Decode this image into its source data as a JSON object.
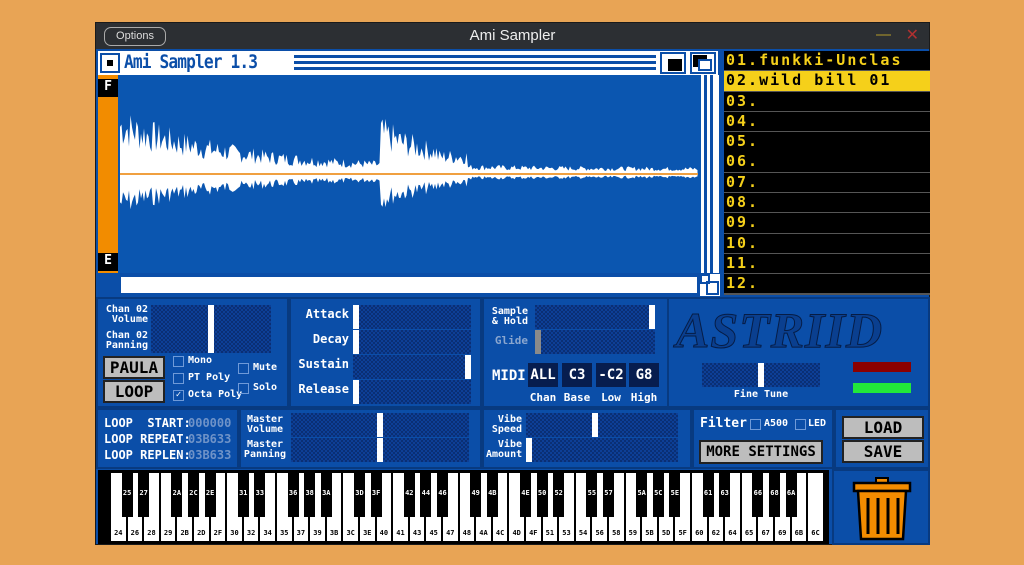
{
  "window": {
    "title": "Ami Sampler",
    "options_label": "Options",
    "minimize_glyph": "—",
    "close_glyph": "✕"
  },
  "app": {
    "title": "Ami Sampler 1.3",
    "wave_top_label": "F",
    "wave_bottom_label": "E"
  },
  "samples": [
    "01.funkki-Unclas",
    "02.wild bill 01",
    "03.",
    "04.",
    "05.",
    "06.",
    "07.",
    "08.",
    "09.",
    "10.",
    "11.",
    "12."
  ],
  "selected_sample": 1,
  "channel": {
    "volume_label": [
      "Chan 02",
      "Volume"
    ],
    "panning_label": [
      "Chan 02",
      "Panning"
    ],
    "volume": 0.5,
    "panning": 0.5,
    "paula_label": "PAULA",
    "loop_label": "LOOP",
    "options": [
      {
        "label": "Mono",
        "checked": false
      },
      {
        "label": "PT Poly",
        "checked": false
      },
      {
        "label": "Octa Poly",
        "checked": true
      },
      {
        "label": "Mute",
        "checked": false
      },
      {
        "label": "Solo",
        "checked": false
      }
    ]
  },
  "envelope": {
    "attack_label": "Attack",
    "decay_label": "Decay",
    "sustain_label": "Sustain",
    "release_label": "Release",
    "attack": 0,
    "decay": 0,
    "sustain": 1,
    "release": 0
  },
  "fx": {
    "sample_hold_label": [
      "Sample",
      "& Hold"
    ],
    "glide_label": "Glide",
    "sample_hold": 1,
    "glide": 0
  },
  "midi": {
    "label": "MIDI",
    "chan": "ALL",
    "base": "C3",
    "low": "-C2",
    "high": "G8",
    "chan_label": "Chan",
    "base_label": "Base",
    "low_label": "Low",
    "high_label": "High"
  },
  "brand": "ASTRIID",
  "fine_tune": {
    "label": "Fine Tune",
    "value": 0.5
  },
  "indicators": {
    "red": "#8b0000",
    "green": "#22e83a"
  },
  "loop": {
    "start_label": "LOOP  START:",
    "repeat_label": "LOOP REPEAT:",
    "replen_label": "LOOP REPLEN:",
    "start": "000000",
    "repeat": "03B633",
    "replen": "03B633"
  },
  "master": {
    "volume_label": [
      "Master",
      "Volume"
    ],
    "panning_label": [
      "Master",
      "Panning"
    ],
    "volume": 0.5,
    "panning": 0.5
  },
  "vibe": {
    "speed_label": [
      "Vibe",
      "Speed"
    ],
    "amount_label": [
      "Vibe",
      "Amount"
    ],
    "speed": 0.45,
    "amount": 0
  },
  "filter": {
    "label": "Filter",
    "a500_label": "A500",
    "led_label": "LED",
    "a500": false,
    "led": false,
    "more_settings_label": "MORE SETTINGS"
  },
  "file": {
    "load_label": "LOAD",
    "save_label": "SAVE"
  },
  "keyboard": {
    "white_keys": [
      "24",
      "26",
      "28",
      "29",
      "2B",
      "2D",
      "2F",
      "30",
      "32",
      "34",
      "35",
      "37",
      "39",
      "3B",
      "3C",
      "3E",
      "40",
      "41",
      "43",
      "45",
      "47",
      "48",
      "4A",
      "4C",
      "4D",
      "4F",
      "51",
      "53",
      "54",
      "56",
      "58",
      "59",
      "5B",
      "5D",
      "5F",
      "60",
      "62",
      "64",
      "65",
      "67",
      "69",
      "6B",
      "6C"
    ],
    "black_keys": [
      "25",
      "27",
      "2A",
      "2C",
      "2E",
      "31",
      "33",
      "36",
      "38",
      "3A",
      "3D",
      "3F",
      "42",
      "44",
      "46",
      "49",
      "4B",
      "4E",
      "50",
      "52",
      "55",
      "57",
      "5A",
      "5C",
      "5E",
      "61",
      "63",
      "66",
      "68",
      "6A"
    ]
  }
}
